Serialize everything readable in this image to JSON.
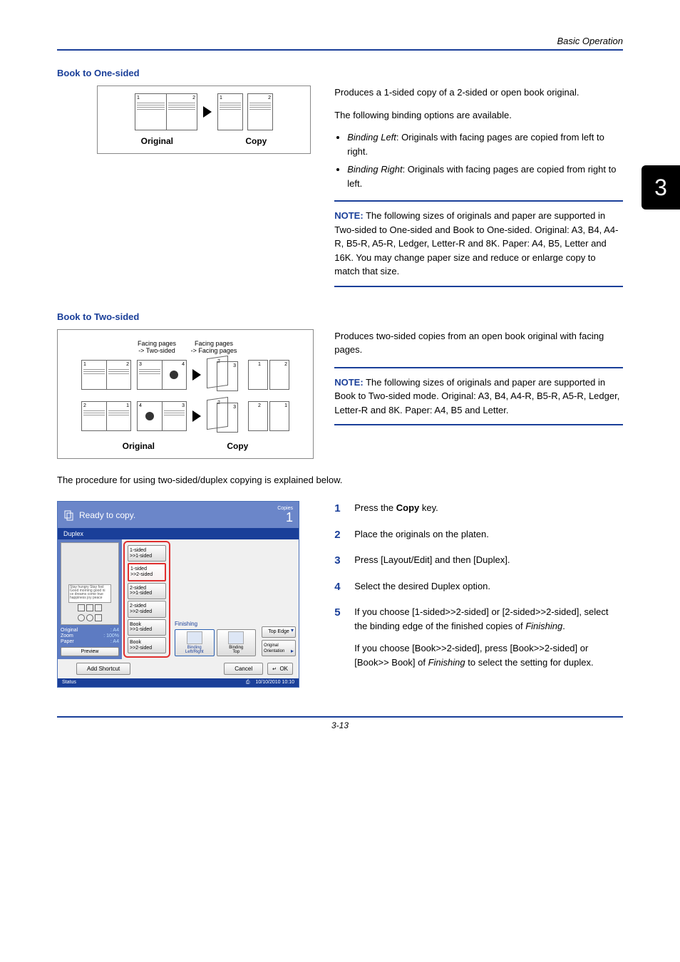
{
  "header": {
    "section": "Basic Operation"
  },
  "chapter_tab": "3",
  "book_one_sided": {
    "title": "Book to One-sided",
    "original_label": "Original",
    "copy_label": "Copy",
    "para1": "Produces a 1-sided copy of a 2-sided or open book original.",
    "para2": "The following binding options are available.",
    "bullets": [
      {
        "term": "Binding Left",
        "text": ": Originals with facing pages are copied from left to right."
      },
      {
        "term": "Binding Right",
        "text": ": Originals with facing pages are copied from right to left."
      }
    ],
    "note_label": "NOTE:",
    "note_text": " The following sizes of originals and paper are supported in Two-sided to One-sided and Book to One-sided. Original: A3, B4, A4-R, B5-R, A5-R, Ledger, Letter-R and 8K. Paper: A4, B5, Letter and 16K. You may change paper size and reduce or enlarge copy to match that size."
  },
  "book_two_sided": {
    "title": "Book to Two-sided",
    "facing_a": "Facing pages\n-> Two-sided",
    "facing_b": "Facing pages\n-> Facing pages",
    "original_label": "Original",
    "copy_label": "Copy",
    "para1": "Produces two-sided copies from an open book original with facing pages.",
    "note_label": "NOTE:",
    "note_text": " The following sizes of originals and paper are supported in Book to Two-sided mode. Original: A3, B4, A4-R, B5-R, A5-R, Ledger, Letter-R and 8K. Paper: A4, B5 and Letter."
  },
  "procedure_intro": "The procedure for using two-sided/duplex copying is explained below.",
  "steps": {
    "s1": {
      "pre": "Press the ",
      "bold": "Copy",
      "post": " key."
    },
    "s2": "Place the originals on the platen.",
    "s3": "Press [Layout/Edit] and then [Duplex].",
    "s4": "Select the desired Duplex option.",
    "s5a": {
      "pre": "If you choose [1-sided>>2-sided] or [2-sided>>2-sided], select the binding edge of the finished copies of ",
      "ital": "Finishing",
      "post": "."
    },
    "s5b": {
      "pre": "If you choose [Book>>2-sided], press [Book>>2-sided] or [Book>> Book] of ",
      "ital": "Finishing",
      "post": " to select the setting for duplex."
    }
  },
  "screen": {
    "title": "Ready to copy.",
    "copies_label": "Copies",
    "copies_value": "1",
    "panel": "Duplex",
    "info": {
      "original_k": "Original",
      "original_v": ": A4",
      "zoom_k": "Zoom",
      "zoom_v": ": 100%",
      "paper_k": "Paper",
      "paper_v": ": A4"
    },
    "preview_btn": "Preview",
    "options": {
      "o1": "1-sided\n>>1-sided",
      "o2": "1-sided\n>>2-sided",
      "o3": "2-sided\n>>1-sided",
      "o4": "2-sided\n>>2-sided",
      "o5": "Book\n>>1-sided",
      "o6": "Book\n>>2-sided"
    },
    "finishing_label": "Finishing",
    "bind_lr": "Binding\nLeft/Right",
    "bind_top": "Binding\nTop",
    "top_edge": "Top Edge",
    "orig_orient": "Original\nOrientation",
    "add_shortcut": "Add Shortcut",
    "cancel": "Cancel",
    "ok": "OK",
    "status": "Status",
    "timestamp": "10/10/2010 10:10"
  },
  "footer": "3-13"
}
